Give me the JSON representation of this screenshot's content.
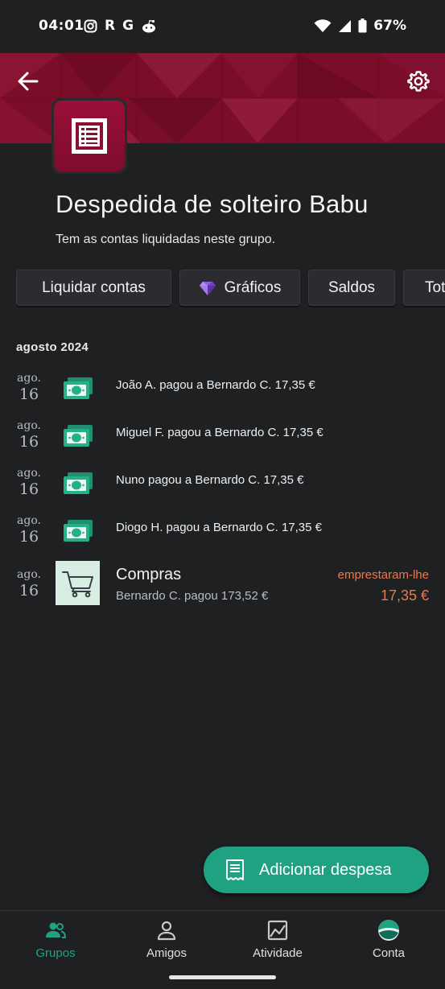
{
  "status_bar": {
    "time": "04:01",
    "app_icons": [
      "instagram-icon",
      "R",
      "G",
      "reddit-icon"
    ],
    "battery": "67%"
  },
  "group": {
    "title": "Despedida de solteiro Babu",
    "subtitle": "Tem as contas liquidadas neste grupo.",
    "banner_color": "#7d0e2a"
  },
  "chips": [
    {
      "label": "Liquidar contas"
    },
    {
      "label": "Gráficos",
      "icon": "gem-icon"
    },
    {
      "label": "Saldos"
    },
    {
      "label": "Tot"
    }
  ],
  "month": "agosto 2024",
  "payments": [
    {
      "month": "ago.",
      "day": "16",
      "text": "João A. pagou a Bernardo C. 17,35 €"
    },
    {
      "month": "ago.",
      "day": "16",
      "text": "Miguel F. pagou a Bernardo C. 17,35 €"
    },
    {
      "month": "ago.",
      "day": "16",
      "text": "Nuno pagou a Bernardo C. 17,35 €"
    },
    {
      "month": "ago.",
      "day": "16",
      "text": "Diogo H. pagou a Bernardo C. 17,35 €"
    }
  ],
  "expense": {
    "month": "ago.",
    "day": "16",
    "title": "Compras",
    "subtitle": "Bernardo C. pagou 173,52 €",
    "status": "emprestaram-lhe",
    "amount": "17,35 €",
    "status_color": "#e8794e"
  },
  "fab": {
    "label": "Adicionar despesa",
    "color": "#1ea281"
  },
  "nav": {
    "items": [
      {
        "label": "Grupos",
        "icon": "groups-icon",
        "active": true
      },
      {
        "label": "Amigos",
        "icon": "person-icon"
      },
      {
        "label": "Atividade",
        "icon": "activity-icon"
      },
      {
        "label": "Conta",
        "icon": "account-icon"
      }
    ],
    "active_color": "#1ea281"
  }
}
